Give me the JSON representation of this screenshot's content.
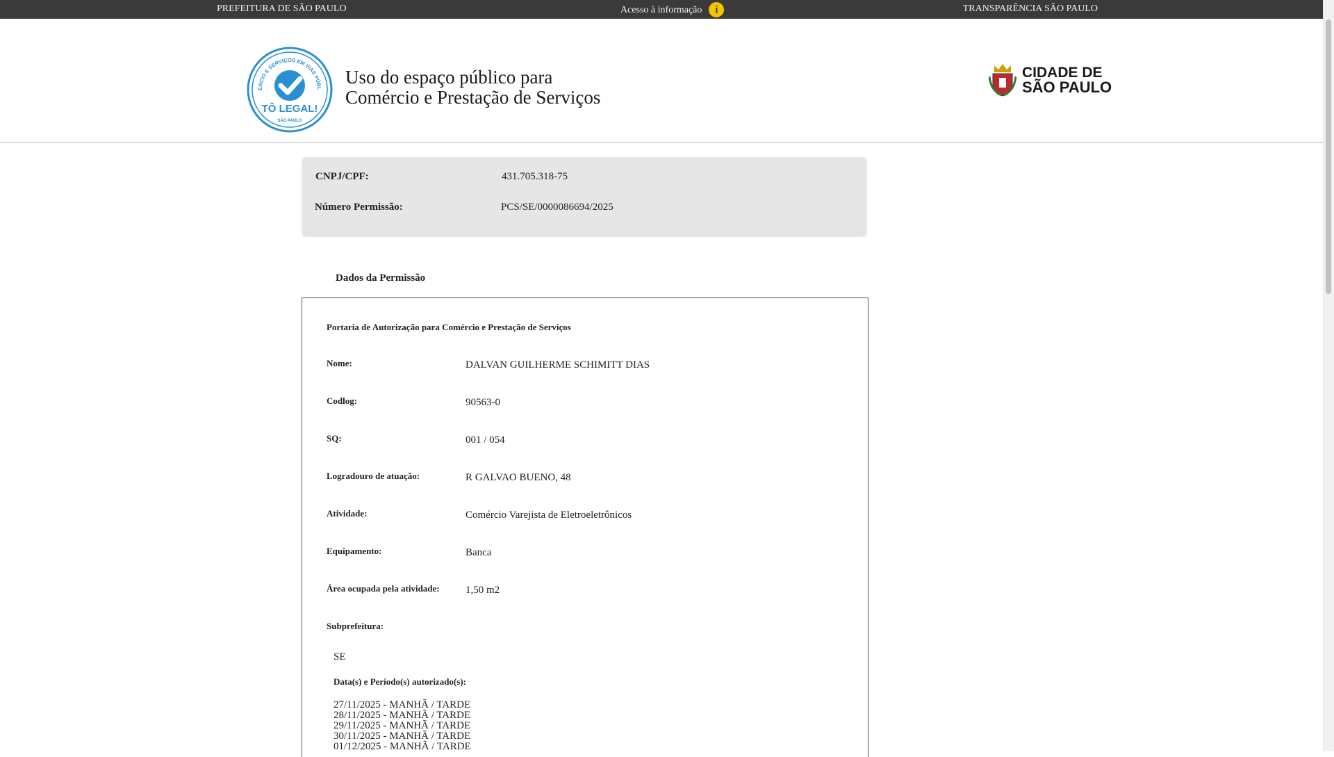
{
  "topbar": {
    "left_link": "PREFEITURA DE SÃO PAULO",
    "center_link": "Acesso à informação",
    "center_icon": "info-icon",
    "right_link": "TRANSPARÊNCIA SÃO PAULO"
  },
  "header": {
    "seal_top_text": "COMÉRCIO E SERVIÇOS EM VIAS PÚBLICAS",
    "seal_main_text": "TÔ LEGAL!",
    "seal_bottom_text": "SÃO PAULO",
    "title_line1": "Uso do espaço público para",
    "title_line2": "Comércio e Prestação de Serviços",
    "city_logo_line1": "CIDADE DE",
    "city_logo_line2": "SÃO PAULO"
  },
  "summary": {
    "cnpj_label": "CNPJ/CPF:",
    "cnpj_value": "431.705.318-75",
    "permissao_label": "Número Permissão:",
    "permissao_value": "PCS/SE/0000086694/2025"
  },
  "section_title": "Dados da Permissão",
  "permission": {
    "portaria": "Portaria de Autorização para Comércio e Prestação de Serviços",
    "fields": [
      {
        "label": "Nome:",
        "value": "DALVAN GUILHERME SCHIMITT DIAS"
      },
      {
        "label": "Codlog:",
        "value": "90563-0"
      },
      {
        "label": "SQ:",
        "value": "001 / 054"
      },
      {
        "label": "Logradouro de atuação:",
        "value": "R GALVAO BUENO, 48"
      },
      {
        "label": "Atividade:",
        "value": "Comércio Varejista de Eletroeletrônicos"
      },
      {
        "label": "Equipamento:",
        "value": "Banca"
      },
      {
        "label": "Área ocupada pela atividade:",
        "value": "1,50 m2"
      }
    ],
    "subprefeitura_label": "Subprefeitura:",
    "subprefeitura_value": "SE",
    "periodos_label": "Data(s) e Período(s) autorizado(s):",
    "periodos": [
      "27/11/2025 - MANHÃ / TARDE",
      "28/11/2025 - MANHÃ / TARDE",
      "29/11/2025 - MANHÃ / TARDE",
      "30/11/2025 - MANHÃ / TARDE",
      "01/12/2025 - MANHÃ / TARDE"
    ]
  },
  "colors": {
    "topbar": "#3a3a3a",
    "seal_blue": "#2a8fd0",
    "summary_bg": "#e6e6e6"
  }
}
